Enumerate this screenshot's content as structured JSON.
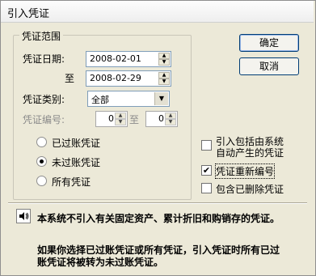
{
  "window": {
    "title": "引入凭证"
  },
  "range_group": {
    "legend": "凭证范围",
    "date_label": "凭证日期:",
    "date_from": "2008-02-01",
    "to_label": "至",
    "date_to": "2008-02-29",
    "type_label": "凭证类别:",
    "type_value": "全部",
    "number_label": "凭证编号:",
    "number_from": "0",
    "number_to_label": "至",
    "number_to": "0"
  },
  "radios": [
    {
      "label": "已过账凭证",
      "selected": false
    },
    {
      "label": "未过账凭证",
      "selected": true
    },
    {
      "label": "所有凭证",
      "selected": false
    }
  ],
  "checkboxes": {
    "include_system_line1": "引入包括由系统",
    "include_system_line2": "自动产生的凭证",
    "renumber": "凭证重新编号",
    "include_deleted": "包含已删除凭证"
  },
  "buttons": {
    "ok": "确定",
    "cancel": "取消"
  },
  "notices": {
    "line1": "本系统不引入有关固定资产、累计折旧和购销存的凭证。",
    "line2": "如果你选择已过账凭证或所有凭证，引入凭证时所有已过",
    "line3": "账凭证将被转为未过账凭证。"
  }
}
